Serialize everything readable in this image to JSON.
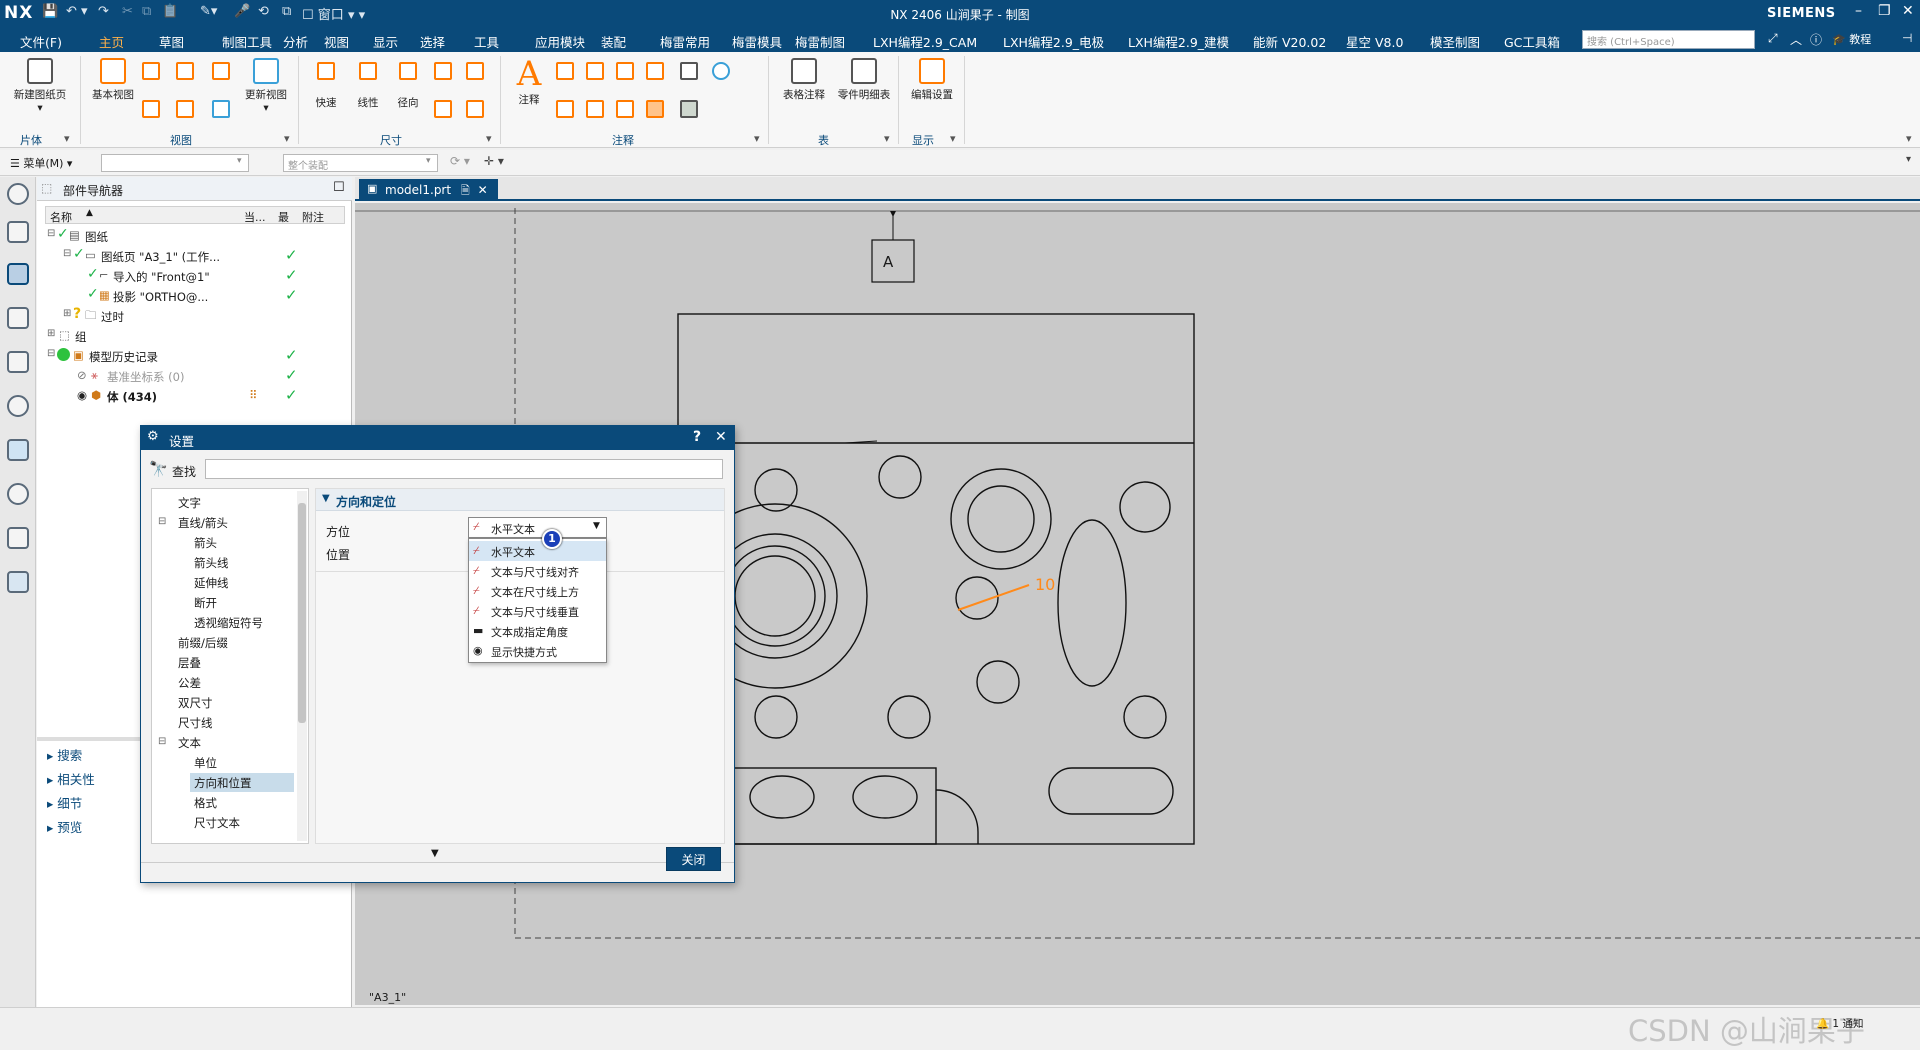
{
  "titlebar": {
    "logo": "NX",
    "window_menu": "窗口",
    "title": "NX 2406 山涧果子 - 制图",
    "brand": "SIEMENS"
  },
  "menubar": {
    "file": "文件(F)",
    "tabs": [
      "主页",
      "草图",
      "制图工具",
      "分析",
      "视图",
      "显示",
      "选择",
      "工具",
      "应用模块",
      "装配",
      "梅雷常用",
      "梅雷模具",
      "梅雷制图",
      "LXH编程2.9_CAM",
      "LXH编程2.9_电极",
      "LXH编程2.9_建模",
      "能新 V20.02",
      "星空 V8.0",
      "模圣制图",
      "GC工具箱"
    ],
    "active_tab": "主页",
    "search_placeholder": "搜索 (Ctrl+Space)",
    "tutorial": "教程"
  },
  "ribbon": {
    "buttons": {
      "new_sheet": "新建图纸页",
      "base_view": "基本视图",
      "update_view": "更新视图",
      "quick": "快速",
      "linear": "线性",
      "radial": "径向",
      "note": "注释",
      "table_note": "表格注释",
      "parts_list": "零件明细表",
      "edit_settings": "编辑设置"
    },
    "groups": {
      "sheet": "片体",
      "view": "视图",
      "dimension": "尺寸",
      "annotation": "注释",
      "table": "表",
      "display": "显示"
    }
  },
  "toolbar2": {
    "menu_label": "菜单(M)",
    "filter_value": "",
    "scope_value": "整个装配"
  },
  "navigator": {
    "title": "部件导航器",
    "columns": [
      "名称",
      "当...",
      "最",
      "附注"
    ],
    "rows": [
      {
        "label": "图纸"
      },
      {
        "label": "图纸页 \"A3_1\" (工作..."
      },
      {
        "label": "导入的 \"Front@1\""
      },
      {
        "label": "投影 \"ORTHO@..."
      },
      {
        "label": "过时"
      },
      {
        "label": "组"
      },
      {
        "label": "模型历史记录"
      },
      {
        "label": "基准坐标系 (0)"
      },
      {
        "label": "体 (434)"
      }
    ],
    "bottom_sections": [
      "搜索",
      "相关性",
      "细节",
      "预览"
    ]
  },
  "tab": {
    "label": "model1.prt"
  },
  "drawing": {
    "sheet_name": "\"A3_1\"",
    "datum_label": "A",
    "dimension_value": "10"
  },
  "dialog": {
    "title": "设置",
    "find_label": "查找",
    "find_value": "",
    "tree": [
      {
        "label": "文字",
        "level": 0
      },
      {
        "label": "直线/箭头",
        "level": 0
      },
      {
        "label": "箭头",
        "level": 1
      },
      {
        "label": "箭头线",
        "level": 1
      },
      {
        "label": "延伸线",
        "level": 1
      },
      {
        "label": "断开",
        "level": 1
      },
      {
        "label": "透视缩短符号",
        "level": 1
      },
      {
        "label": "前缀/后缀",
        "level": 0
      },
      {
        "label": "层叠",
        "level": 0
      },
      {
        "label": "公差",
        "level": 0
      },
      {
        "label": "双尺寸",
        "level": 0
      },
      {
        "label": "尺寸线",
        "level": 0
      },
      {
        "label": "文本",
        "level": 0
      },
      {
        "label": "单位",
        "level": 1
      },
      {
        "label": "方向和位置",
        "level": 1
      },
      {
        "label": "格式",
        "level": 1
      },
      {
        "label": "尺寸文本",
        "level": 1
      }
    ],
    "selected_tree_item": "方向和位置",
    "section_title": "方向和定位",
    "orientation_label": "方位",
    "position_label": "位置",
    "orientation_value": "水平文本",
    "dropdown_options": [
      "水平文本",
      "文本与尺寸线对齐",
      "文本在尺寸线上方",
      "文本与尺寸线垂直",
      "文本成指定角度",
      "显示快捷方式"
    ],
    "badge": "1",
    "close_button": "关闭"
  },
  "statusbar": {
    "notification": "1 通知",
    "watermark": "CSDN @山涧果子"
  },
  "colors": {
    "brand": "#0a4a7a",
    "accent": "#ffb14a",
    "check": "#1fb34a",
    "dimension": "#ff8a1a"
  }
}
